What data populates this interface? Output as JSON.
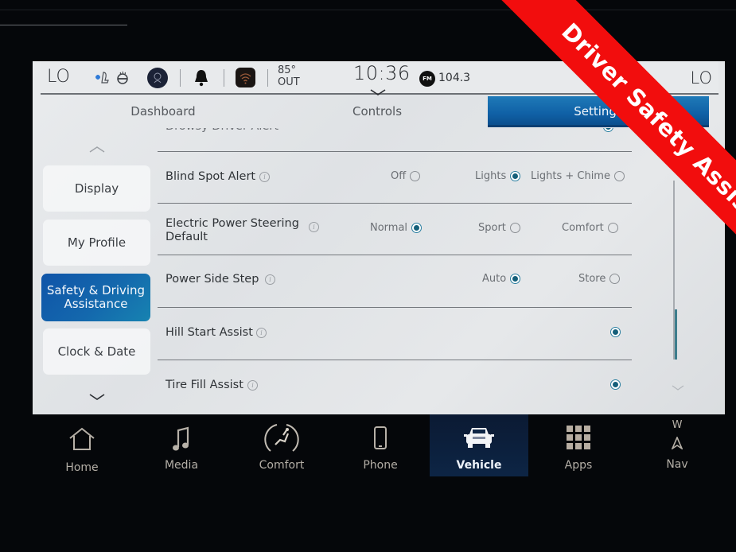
{
  "status_bar": {
    "left_temp": "LO",
    "right_temp": "LO",
    "outside_temp": "85°",
    "outside_label": "OUT",
    "time": "10:36",
    "radio_band": "FM",
    "radio_frequency": "104.3",
    "icons": [
      "seat-fan-icon",
      "steering-wheel-heat-icon",
      "driver-profile-icon",
      "notification-bell-icon",
      "wireless-icon"
    ]
  },
  "tabs": [
    {
      "label": "Dashboard",
      "active": false
    },
    {
      "label": "Controls",
      "active": false
    },
    {
      "label": "Settings",
      "active": true
    }
  ],
  "sidebar": {
    "items": [
      {
        "label": "Display",
        "active": false
      },
      {
        "label": "My Profile",
        "active": false
      },
      {
        "label": "Safety & Driving Assistance",
        "active": true
      },
      {
        "label": "Clock & Date",
        "active": false
      }
    ]
  },
  "settings": {
    "rows": [
      {
        "label": "Drowsy Driver Alert",
        "options": [
          {
            "label": "",
            "selected": true
          }
        ]
      },
      {
        "label": "Blind Spot Alert",
        "options": [
          {
            "label": "Off",
            "selected": false
          },
          {
            "label": "Lights",
            "selected": true
          },
          {
            "label": "Lights + Chime",
            "selected": false
          }
        ]
      },
      {
        "label": "Electric Power Steering Default",
        "options": [
          {
            "label": "Normal",
            "selected": true
          },
          {
            "label": "Sport",
            "selected": false
          },
          {
            "label": "Comfort",
            "selected": false
          }
        ]
      },
      {
        "label": "Power Side Step",
        "options": [
          {
            "label": "Auto",
            "selected": true
          },
          {
            "label": "Store",
            "selected": false
          }
        ]
      },
      {
        "label": "Hill Start Assist",
        "options": [
          {
            "label": "",
            "selected": true
          }
        ]
      },
      {
        "label": "Tire Fill Assist",
        "options": [
          {
            "label": "",
            "selected": true
          }
        ]
      }
    ],
    "scroll_position": 0.85
  },
  "bottom_nav": {
    "items": [
      {
        "label": "Home",
        "icon": "home-icon",
        "active": false
      },
      {
        "label": "Media",
        "icon": "music-note-icon",
        "active": false
      },
      {
        "label": "Comfort",
        "icon": "seat-comfort-icon",
        "active": false
      },
      {
        "label": "Phone",
        "icon": "phone-icon",
        "active": false
      },
      {
        "label": "Vehicle",
        "icon": "vehicle-icon",
        "active": true
      },
      {
        "label": "Apps",
        "icon": "apps-grid-icon",
        "active": false
      },
      {
        "label": "Nav",
        "icon": "nav-arrow-icon",
        "active": false,
        "heading": "W"
      }
    ]
  },
  "banner": {
    "text": "Driver Safety Assist",
    "color": "#f20d0d"
  },
  "colors": {
    "accent": "#1061a6",
    "radio_selected": "#155f7a"
  }
}
